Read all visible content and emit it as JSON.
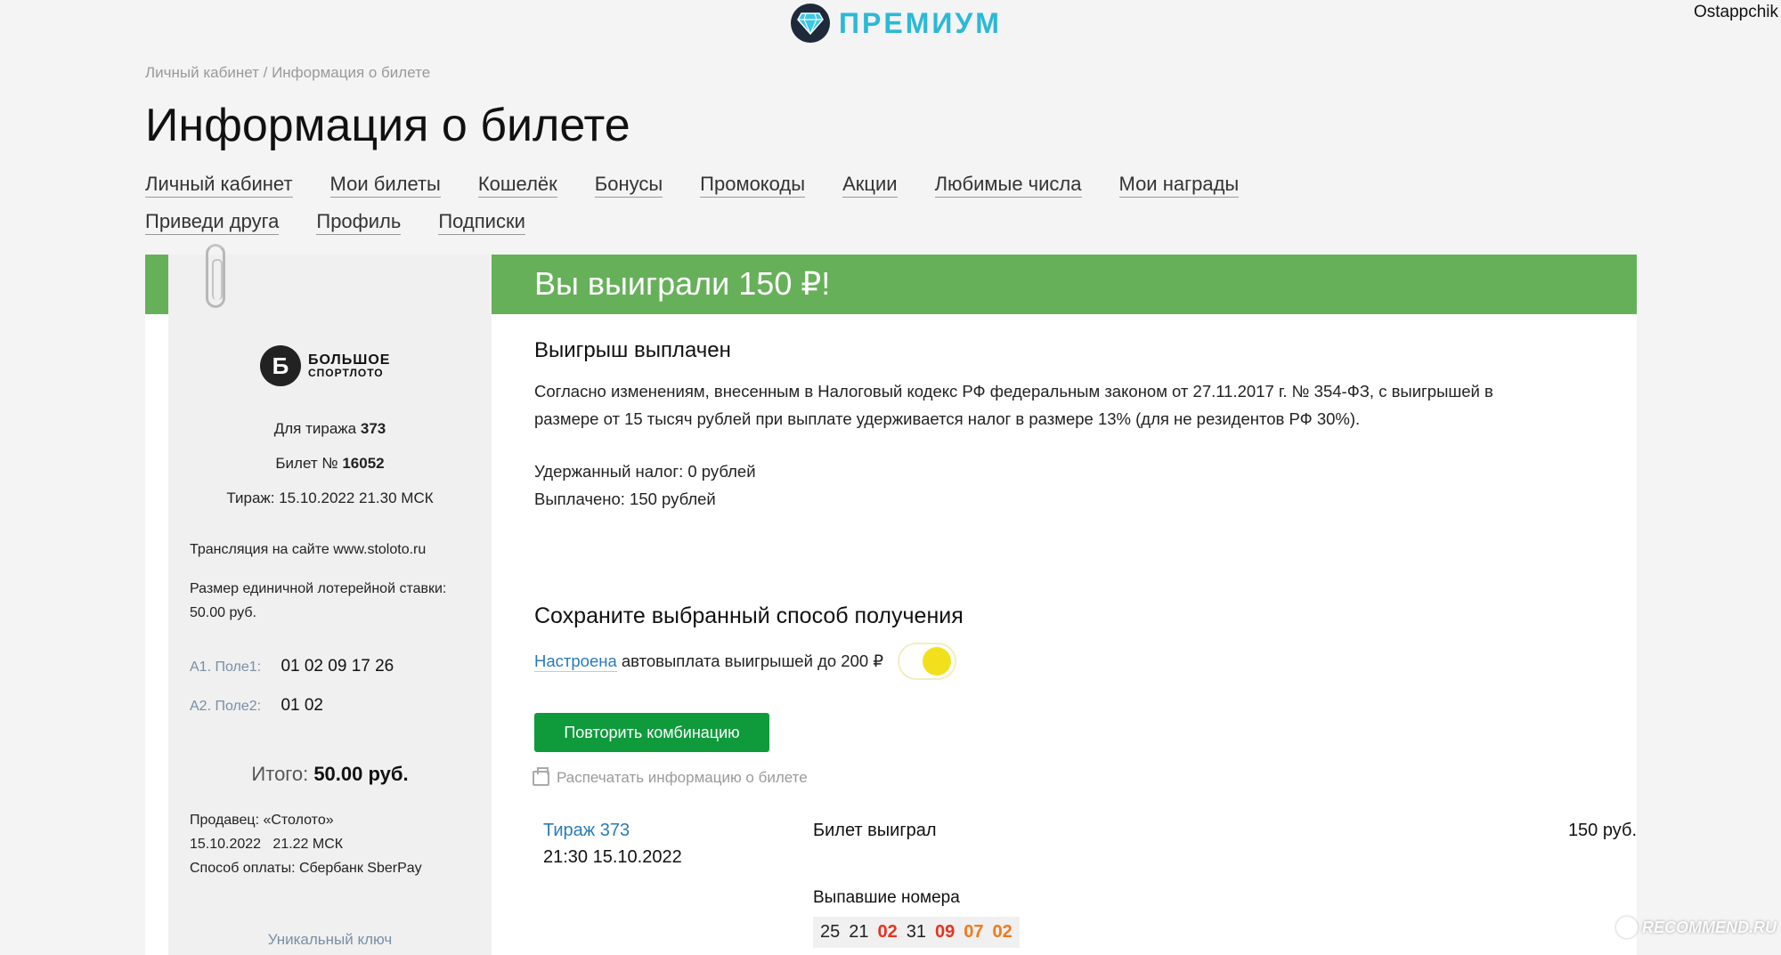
{
  "header": {
    "premium_label": "ПРЕМИУМ",
    "username": "Ostappchik",
    "accent_color": "#2ab9d6"
  },
  "breadcrumb": "Личный кабинет / Информация о билете",
  "page_title": "Информация о билете",
  "nav": {
    "row1": [
      "Личный кабинет",
      "Мои билеты",
      "Кошелёк",
      "Бонусы",
      "Промокоды",
      "Акции",
      "Любимые числа",
      "Мои награды"
    ],
    "row2": [
      "Приведи друга",
      "Профиль",
      "Подписки"
    ]
  },
  "ticket": {
    "brand_line1": "БОЛЬШОЕ",
    "brand_line2": "СПОРТЛОТО",
    "draw_label": "Для тиража",
    "draw_number": "373",
    "ticket_label": "Билет №",
    "ticket_number": "16052",
    "draw_datetime": "Тираж: 15.10.2022 21.30 МСК",
    "broadcast": "Трансляция на сайте www.stoloto.ru",
    "stake": "Размер единичной лотерейной ставки: 50.00 руб.",
    "field1_label": "А1. Поле1:",
    "field1_numbers": "01 02 09 17 26",
    "field2_label": "А2. Поле2:",
    "field2_numbers": "01 02",
    "total_label": "Итого:",
    "total_value": "50.00 руб.",
    "seller": "Продавец: «Столото»",
    "sale_datetime": "15.10.2022   21.22 МСК",
    "payment": "Способ оплаты: Сбербанк SberPay",
    "unique_key_label": "Уникальный ключ"
  },
  "result": {
    "banner_title": "Вы выиграли 150 ₽!",
    "banner_color": "#67b05a",
    "paid_heading": "Выигрыш выплачен",
    "tax_note": "Согласно изменениям, внесенным в Налоговый кодекс РФ федеральным законом от 27.11.2017 г. № 354-ФЗ, с выигрышей в размере от 15 тысяч рублей при выплате удерживается налог в размере 13% (для не резидентов РФ 30%).",
    "tax_withheld": "Удержанный налог: 0 рублей",
    "paid_out": "Выплачено: 150 рублей",
    "save_heading": "Сохраните выбранный способ получения",
    "auto_link": "Настроена",
    "auto_text": " автовыплата выигрышей до 200 ₽",
    "auto_toggle_on": true,
    "repeat_button": "Повторить комбинацию",
    "print_link": "Распечатать информацию о билете"
  },
  "draw": {
    "link": "Тираж 373",
    "datetime": "21:30 15.10.2022",
    "status": "Билет выиграл",
    "prize": "150 руб.",
    "drawn_label": "Выпавшие номера",
    "drawn_numbers": [
      {
        "n": "25",
        "type": "normal"
      },
      {
        "n": "21",
        "type": "normal"
      },
      {
        "n": "02",
        "type": "hit"
      },
      {
        "n": "31",
        "type": "normal"
      },
      {
        "n": "09",
        "type": "hit"
      },
      {
        "n": "07",
        "type": "bonus"
      },
      {
        "n": "02",
        "type": "bonus"
      }
    ]
  },
  "watermark": "RECOMMEND.RU"
}
